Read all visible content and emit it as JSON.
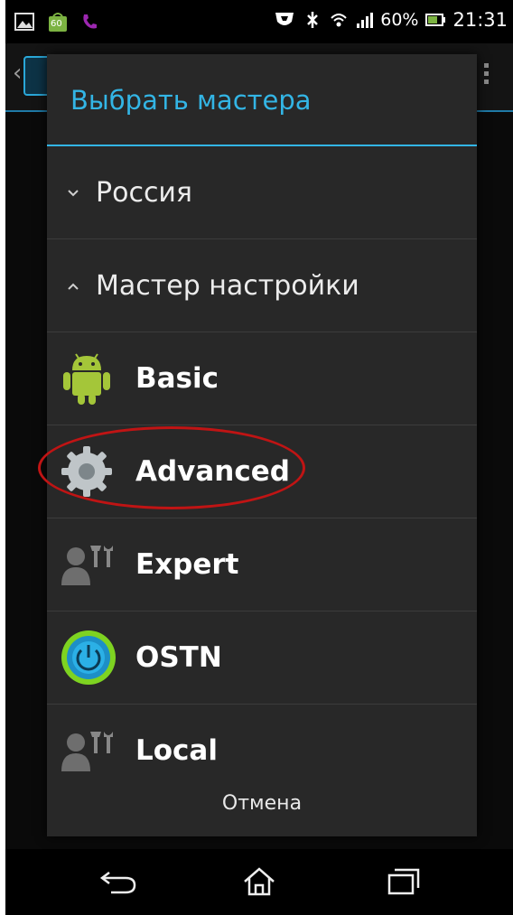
{
  "status_bar": {
    "battery_percent": "60%",
    "time": "21:31",
    "notif_badge": "60",
    "icons": [
      "picture-icon",
      "android-market-icon",
      "phone-icon",
      "shield-icon",
      "bluetooth-off-icon",
      "wifi-icon",
      "signal-icon",
      "battery-icon"
    ]
  },
  "dialog": {
    "title": "Выбрать мастера",
    "groups": [
      {
        "label": "Россия",
        "state": "collapsed"
      },
      {
        "label": "Мастер настройки",
        "state": "expanded"
      }
    ],
    "items": [
      {
        "label": "Basic",
        "icon": "android-robot-icon"
      },
      {
        "label": "Advanced",
        "icon": "gear-icon"
      },
      {
        "label": "Expert",
        "icon": "user-tools-icon"
      },
      {
        "label": "OSTN",
        "icon": "power-globe-icon"
      },
      {
        "label": "Local",
        "icon": "user-tools-icon"
      }
    ],
    "cancel_label": "Отмена"
  },
  "colors": {
    "accent": "#33b5e5",
    "dialog_bg": "#282828",
    "highlight": "#c01414",
    "android_green": "#a4c639"
  },
  "nav_bar": {
    "buttons": [
      "back-icon",
      "home-icon",
      "recent-apps-icon"
    ]
  }
}
